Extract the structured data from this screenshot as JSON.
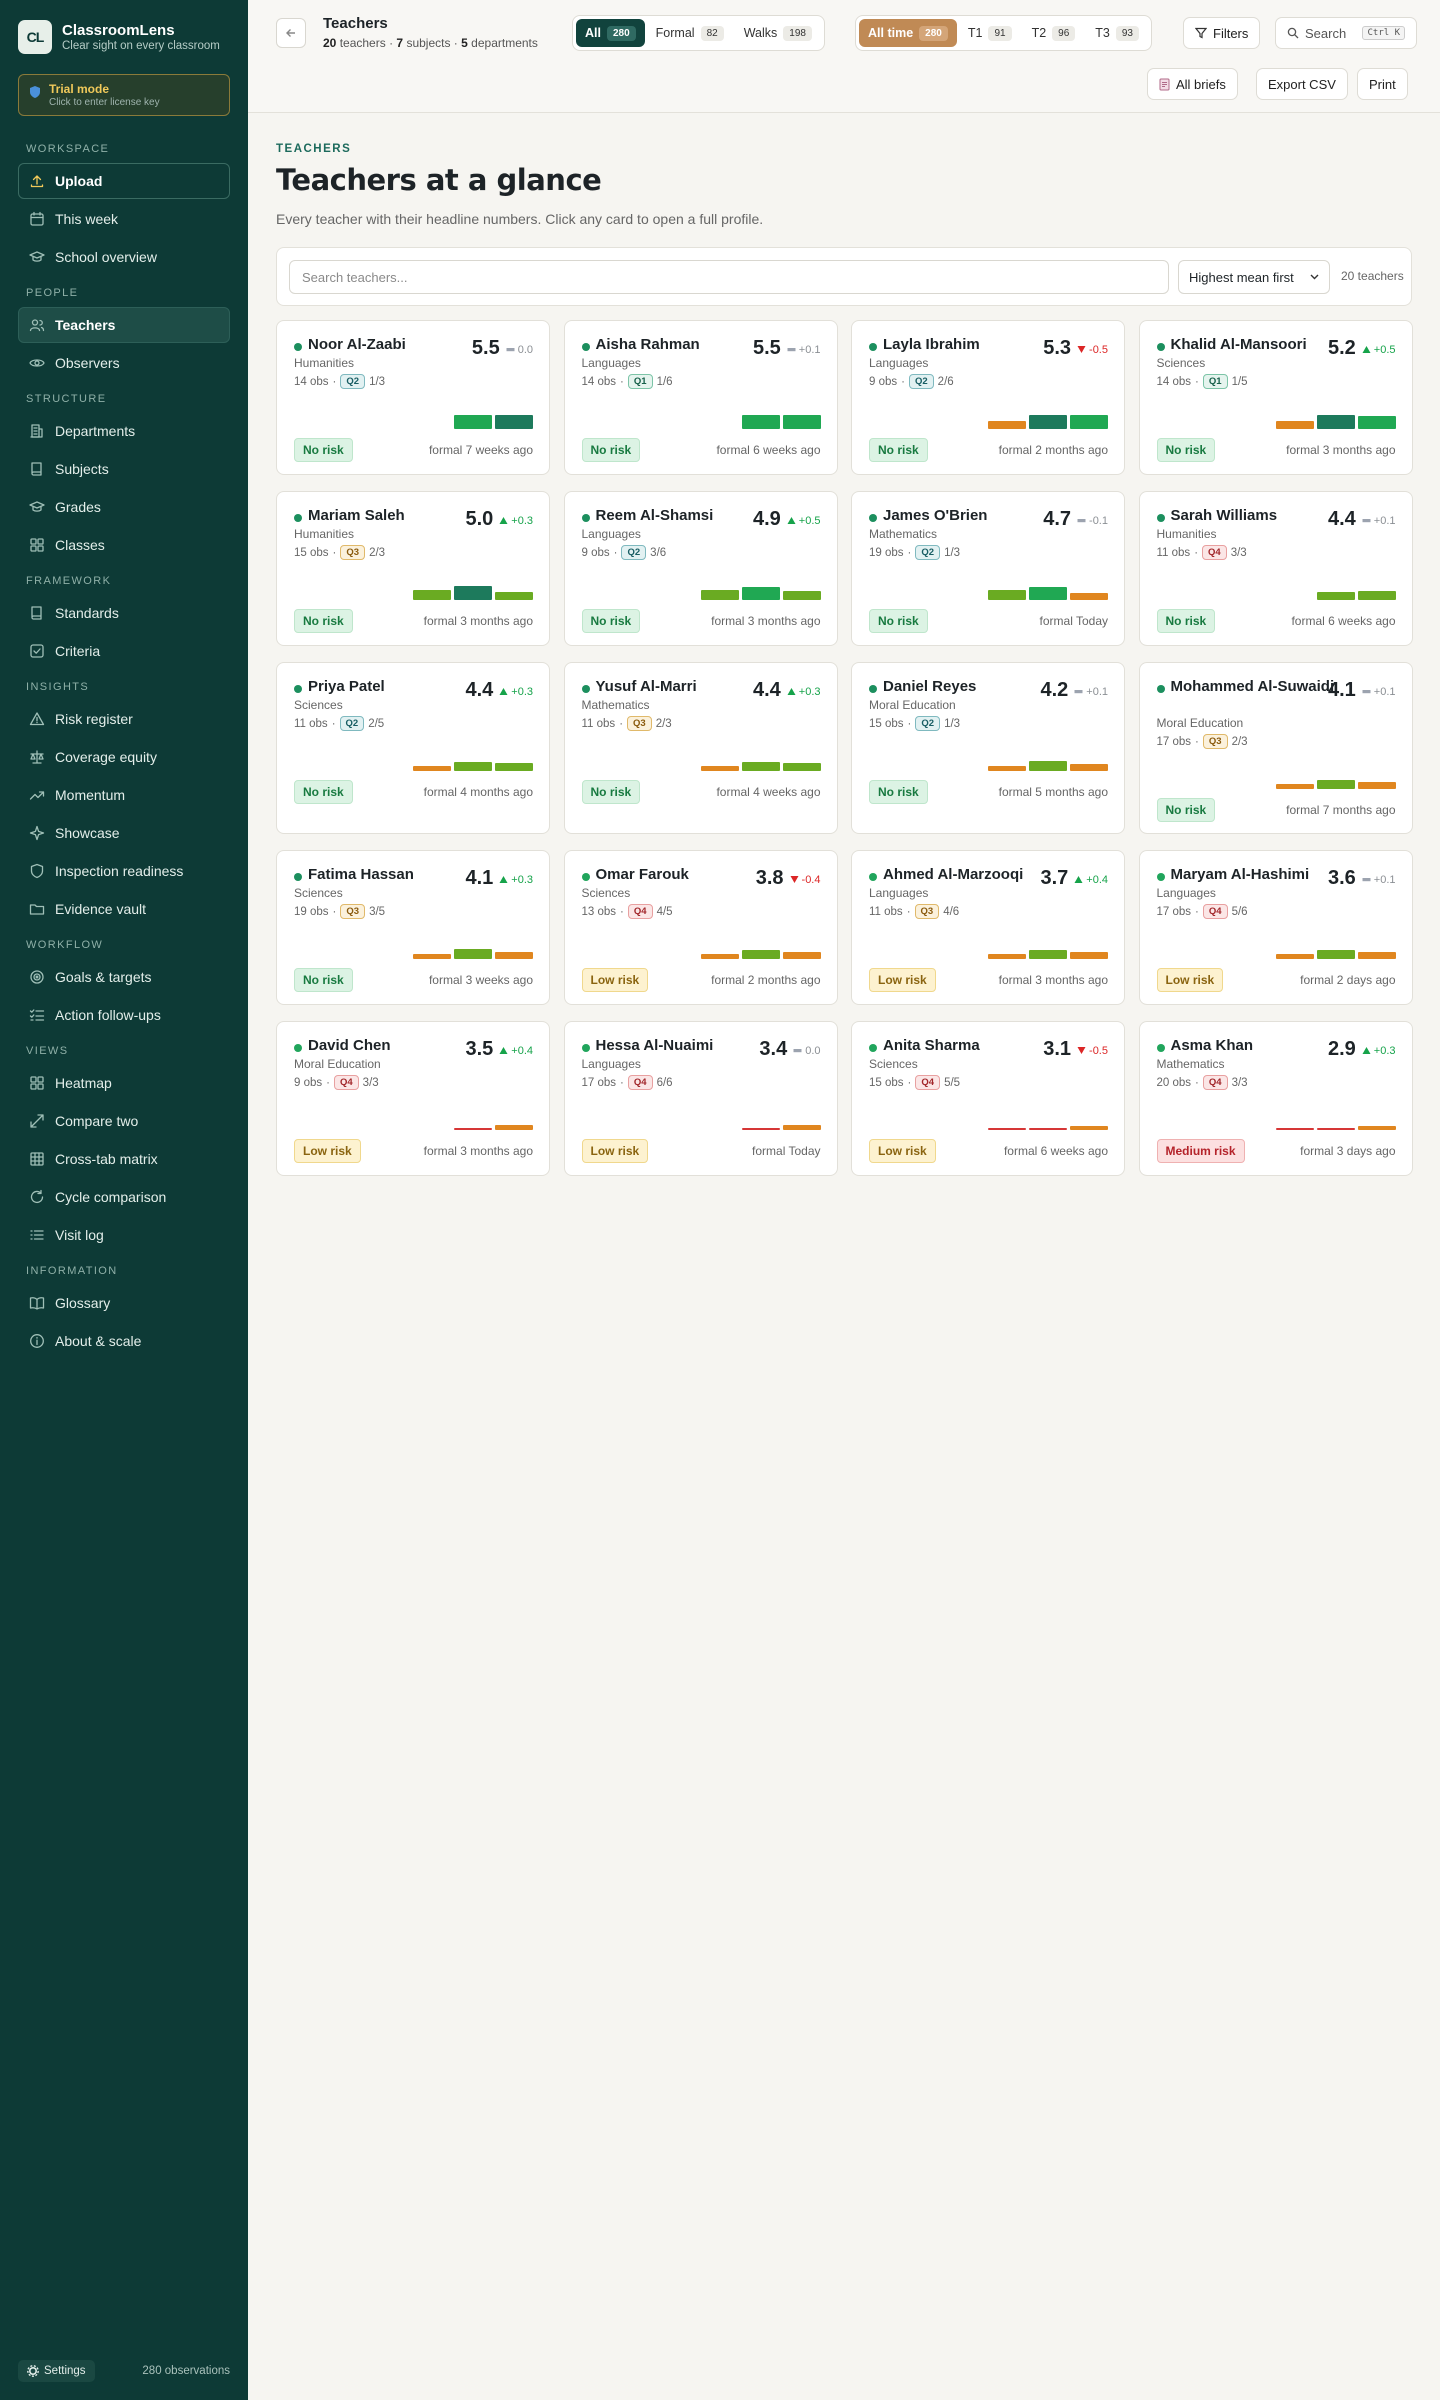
{
  "app": {
    "name": "ClassroomLens",
    "tagline": "Clear sight on every classroom",
    "logo_text": "CL"
  },
  "trial": {
    "title": "Trial mode",
    "subtitle": "Click to enter license key"
  },
  "nav": [
    {
      "section": "WORKSPACE",
      "items": [
        {
          "id": "upload",
          "label": "Upload",
          "icon": "upload-icon"
        },
        {
          "id": "this-week",
          "label": "This week",
          "icon": "calendar-icon"
        },
        {
          "id": "school-overview",
          "label": "School overview",
          "icon": "graduation-cap-icon"
        }
      ]
    },
    {
      "section": "PEOPLE",
      "items": [
        {
          "id": "teachers",
          "label": "Teachers",
          "icon": "users-icon",
          "active": true
        },
        {
          "id": "observers",
          "label": "Observers",
          "icon": "eye-icon"
        }
      ]
    },
    {
      "section": "STRUCTURE",
      "items": [
        {
          "id": "departments",
          "label": "Departments",
          "icon": "building-icon"
        },
        {
          "id": "subjects",
          "label": "Subjects",
          "icon": "book-icon"
        },
        {
          "id": "grades",
          "label": "Grades",
          "icon": "graduation-cap-icon"
        },
        {
          "id": "classes",
          "label": "Classes",
          "icon": "grid-icon"
        }
      ]
    },
    {
      "section": "FRAMEWORK",
      "items": [
        {
          "id": "standards",
          "label": "Standards",
          "icon": "book-icon"
        },
        {
          "id": "criteria",
          "label": "Criteria",
          "icon": "check-square-icon"
        }
      ]
    },
    {
      "section": "INSIGHTS",
      "items": [
        {
          "id": "risk-register",
          "label": "Risk register",
          "icon": "warning-icon"
        },
        {
          "id": "coverage-equity",
          "label": "Coverage equity",
          "icon": "scale-icon"
        },
        {
          "id": "momentum",
          "label": "Momentum",
          "icon": "trending-up-icon"
        },
        {
          "id": "showcase",
          "label": "Showcase",
          "icon": "sparkle-icon"
        },
        {
          "id": "inspection-readiness",
          "label": "Inspection readiness",
          "icon": "shield-icon"
        },
        {
          "id": "evidence-vault",
          "label": "Evidence vault",
          "icon": "folder-icon"
        }
      ]
    },
    {
      "section": "WORKFLOW",
      "items": [
        {
          "id": "goals-targets",
          "label": "Goals & targets",
          "icon": "target-icon"
        },
        {
          "id": "action-follow-ups",
          "label": "Action follow-ups",
          "icon": "list-check-icon"
        }
      ]
    },
    {
      "section": "VIEWS",
      "items": [
        {
          "id": "heatmap",
          "label": "Heatmap",
          "icon": "grid-icon"
        },
        {
          "id": "compare-two",
          "label": "Compare two",
          "icon": "compare-icon"
        },
        {
          "id": "cross-tab-matrix",
          "label": "Cross-tab matrix",
          "icon": "table-icon"
        },
        {
          "id": "cycle-comparison",
          "label": "Cycle comparison",
          "icon": "refresh-icon"
        },
        {
          "id": "visit-log",
          "label": "Visit log",
          "icon": "list-icon"
        }
      ]
    },
    {
      "section": "INFORMATION",
      "items": [
        {
          "id": "glossary",
          "label": "Glossary",
          "icon": "open-book-icon"
        },
        {
          "id": "about-scale",
          "label": "About & scale",
          "icon": "info-icon"
        }
      ]
    }
  ],
  "sidebar_footer": {
    "settings_label": "Settings",
    "observations": "280 observations"
  },
  "topbar": {
    "title": "Teachers",
    "stats": {
      "teachers": "20",
      "teachers_label": "teachers",
      "subjects": "7",
      "subjects_label": "subjects",
      "departments": "5",
      "departments_label": "departments"
    },
    "type_filter": [
      {
        "label": "All",
        "count": "280",
        "active": true
      },
      {
        "label": "Formal",
        "count": "82"
      },
      {
        "label": "Walks",
        "count": "198"
      }
    ],
    "term_filter": [
      {
        "label": "All time",
        "count": "280",
        "active": true
      },
      {
        "label": "T1",
        "count": "91"
      },
      {
        "label": "T2",
        "count": "96"
      },
      {
        "label": "T3",
        "count": "93"
      }
    ],
    "filters_label": "Filters",
    "search_label": "Search",
    "search_shortcut": "Ctrl K",
    "all_briefs_label": "All briefs",
    "export_label": "Export CSV",
    "print_label": "Print"
  },
  "page": {
    "eyebrow": "TEACHERS",
    "title": "Teachers at a glance",
    "description": "Every teacher with their headline numbers. Click any card to open a full profile.",
    "search_placeholder": "Search teachers...",
    "sort_label": "Highest mean first",
    "count_label": "20 teachers"
  },
  "colors": {
    "accent": "#0d3a36",
    "tan": "#c08a55",
    "green": "#16a34a",
    "red": "#dc2626",
    "gray": "#9ca3af"
  },
  "teachers": [
    {
      "name": "Noor Al-Zaabi",
      "dept": "Humanities",
      "obs": "14 obs",
      "quartile": "Q2",
      "rank": "1/3",
      "mean": "5.5",
      "delta": "0.0",
      "dir": "flat",
      "bars": [
        5.3,
        5.5
      ],
      "risk": "No risk",
      "risk_level": "none",
      "last": "formal 7 weeks ago"
    },
    {
      "name": "Aisha Rahman",
      "dept": "Languages",
      "obs": "14 obs",
      "quartile": "Q1",
      "rank": "1/6",
      "mean": "5.5",
      "delta": "+0.1",
      "dir": "flat",
      "bars": [
        5.3,
        5.4
      ],
      "risk": "No risk",
      "risk_level": "none",
      "last": "formal 6 weeks ago"
    },
    {
      "name": "Layla Ibrahim",
      "dept": "Languages",
      "obs": "9 obs",
      "quartile": "Q2",
      "rank": "2/6",
      "mean": "5.3",
      "delta": "-0.5",
      "dir": "down",
      "bars": [
        4.3,
        5.7,
        5.3
      ],
      "risk": "No risk",
      "risk_level": "none",
      "last": "formal 2 months ago"
    },
    {
      "name": "Khalid Al-Mansoori",
      "dept": "Sciences",
      "obs": "14 obs",
      "quartile": "Q1",
      "rank": "1/5",
      "mean": "5.2",
      "delta": "+0.5",
      "dir": "up",
      "bars": [
        4.3,
        5.7,
        5.2
      ],
      "risk": "No risk",
      "risk_level": "none",
      "last": "formal 3 months ago"
    },
    {
      "name": "Mariam Saleh",
      "dept": "Humanities",
      "obs": "15 obs",
      "quartile": "Q3",
      "rank": "2/3",
      "mean": "5.0",
      "delta": "+0.3",
      "dir": "up",
      "bars": [
        4.6,
        5.6,
        4.4
      ],
      "risk": "No risk",
      "risk_level": "none",
      "last": "formal 3 months ago"
    },
    {
      "name": "Reem Al-Shamsi",
      "dept": "Languages",
      "obs": "9 obs",
      "quartile": "Q2",
      "rank": "3/6",
      "mean": "4.9",
      "delta": "+0.5",
      "dir": "up",
      "bars": [
        4.7,
        5.2,
        4.5
      ],
      "risk": "No risk",
      "risk_level": "none",
      "last": "formal 3 months ago"
    },
    {
      "name": "James O'Brien",
      "dept": "Mathematics",
      "obs": "19 obs",
      "quartile": "Q2",
      "rank": "1/3",
      "mean": "4.7",
      "delta": "-0.1",
      "dir": "flat",
      "bars": [
        4.7,
        5.2,
        4.2
      ],
      "risk": "No risk",
      "risk_level": "none",
      "last": "formal Today"
    },
    {
      "name": "Sarah Williams",
      "dept": "Humanities",
      "obs": "11 obs",
      "quartile": "Q4",
      "rank": "3/3",
      "mean": "4.4",
      "delta": "+0.1",
      "dir": "flat",
      "bars": [
        4.4,
        4.5
      ],
      "risk": "No risk",
      "risk_level": "none",
      "last": "formal 6 weeks ago"
    },
    {
      "name": "Priya Patel",
      "dept": "Sciences",
      "obs": "11 obs",
      "quartile": "Q2",
      "rank": "2/5",
      "mean": "4.4",
      "delta": "+0.3",
      "dir": "up",
      "bars": [
        3.8,
        4.5,
        4.4
      ],
      "risk": "No risk",
      "risk_level": "none",
      "last": "formal 4 months ago"
    },
    {
      "name": "Yusuf Al-Marri",
      "dept": "Mathematics",
      "obs": "11 obs",
      "quartile": "Q3",
      "rank": "2/3",
      "mean": "4.4",
      "delta": "+0.3",
      "dir": "up",
      "bars": [
        3.8,
        4.5,
        4.4
      ],
      "risk": "No risk",
      "risk_level": "none",
      "last": "formal 4 weeks ago"
    },
    {
      "name": "Daniel Reyes",
      "dept": "Moral Education",
      "obs": "15 obs",
      "quartile": "Q2",
      "rank": "1/3",
      "mean": "4.2",
      "delta": "+0.1",
      "dir": "flat",
      "bars": [
        3.8,
        4.6,
        4.2
      ],
      "risk": "No risk",
      "risk_level": "none",
      "last": "formal 5 months ago"
    },
    {
      "name": "Mohammed Al-Suwaidi",
      "dept": "Moral Education",
      "obs": "17 obs",
      "quartile": "Q3",
      "rank": "2/3",
      "mean": "4.1",
      "delta": "+0.1",
      "dir": "flat",
      "bars": [
        3.8,
        4.5,
        4.2
      ],
      "risk": "No risk",
      "risk_level": "none",
      "last": "formal 7 months ago"
    },
    {
      "name": "Fatima Hassan",
      "dept": "Sciences",
      "obs": "19 obs",
      "quartile": "Q3",
      "rank": "3/5",
      "mean": "4.1",
      "delta": "+0.3",
      "dir": "up",
      "bars": [
        3.8,
        4.6,
        4.2
      ],
      "risk": "No risk",
      "risk_level": "none",
      "last": "formal 3 weeks ago"
    },
    {
      "name": "Omar Farouk",
      "dept": "Sciences",
      "obs": "13 obs",
      "quartile": "Q4",
      "rank": "4/5",
      "mean": "3.8",
      "delta": "-0.4",
      "dir": "down",
      "bars": [
        3.8,
        4.5,
        4.1
      ],
      "risk": "Low risk",
      "risk_level": "low",
      "last": "formal 2 months ago"
    },
    {
      "name": "Ahmed Al-Marzooqi",
      "dept": "Languages",
      "obs": "11 obs",
      "quartile": "Q3",
      "rank": "4/6",
      "mean": "3.7",
      "delta": "+0.4",
      "dir": "up",
      "bars": [
        3.8,
        4.5,
        4.1
      ],
      "risk": "Low risk",
      "risk_level": "low",
      "last": "formal 3 months ago"
    },
    {
      "name": "Maryam Al-Hashimi",
      "dept": "Languages",
      "obs": "17 obs",
      "quartile": "Q4",
      "rank": "5/6",
      "mean": "3.6",
      "delta": "+0.1",
      "dir": "flat",
      "bars": [
        3.8,
        4.5,
        4.1
      ],
      "risk": "Low risk",
      "risk_level": "low",
      "last": "formal 2 days ago"
    },
    {
      "name": "David Chen",
      "dept": "Moral Education",
      "obs": "9 obs",
      "quartile": "Q4",
      "rank": "3/3",
      "mean": "3.5",
      "delta": "+0.4",
      "dir": "up",
      "bars": [
        3.3,
        3.9
      ],
      "risk": "Low risk",
      "risk_level": "low",
      "last": "formal 3 months ago"
    },
    {
      "name": "Hessa Al-Nuaimi",
      "dept": "Languages",
      "obs": "17 obs",
      "quartile": "Q4",
      "rank": "6/6",
      "mean": "3.4",
      "delta": "0.0",
      "dir": "flat",
      "bars": [
        3.3,
        3.9
      ],
      "risk": "Low risk",
      "risk_level": "low",
      "last": "formal Today"
    },
    {
      "name": "Anita Sharma",
      "dept": "Sciences",
      "obs": "15 obs",
      "quartile": "Q4",
      "rank": "5/5",
      "mean": "3.1",
      "delta": "-0.5",
      "dir": "down",
      "bars": [
        2.7,
        3.4,
        3.7
      ],
      "risk": "Low risk",
      "risk_level": "low",
      "last": "formal 6 weeks ago"
    },
    {
      "name": "Asma Khan",
      "dept": "Mathematics",
      "obs": "20 obs",
      "quartile": "Q4",
      "rank": "3/3",
      "mean": "2.9",
      "delta": "+0.3",
      "dir": "up",
      "bars": [
        2.7,
        3.4,
        3.7
      ],
      "risk": "Medium risk",
      "risk_level": "medium",
      "last": "formal 3 days ago"
    }
  ]
}
